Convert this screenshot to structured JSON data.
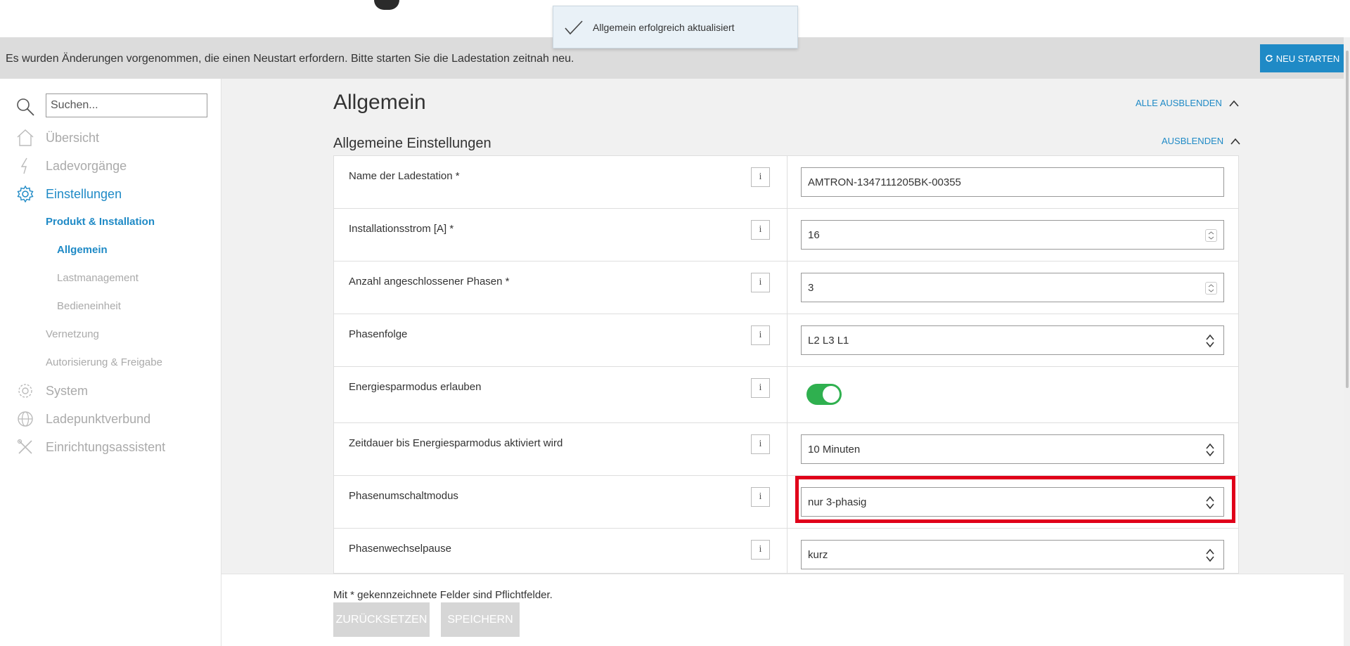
{
  "toast": {
    "message": "Allgemein erfolgreich aktualisiert"
  },
  "notice": {
    "text": "Es wurden Änderungen vorgenommen, die einen Neustart erfordern. Bitte starten Sie die Ladestation zeitnah neu.",
    "restart_label": "NEU STARTEN"
  },
  "sidebar": {
    "search_placeholder": "Suchen...",
    "items": [
      {
        "label": "Übersicht",
        "icon": "home-icon"
      },
      {
        "label": "Ladevorgänge",
        "icon": "lightning-icon"
      },
      {
        "label": "Einstellungen",
        "icon": "gear-icon"
      },
      {
        "label": "Produkt & Installation"
      },
      {
        "label": "Allgemein"
      },
      {
        "label": "Lastmanagement"
      },
      {
        "label": "Bedieneinheit"
      },
      {
        "label": "Vernetzung"
      },
      {
        "label": "Autorisierung & Freigabe"
      },
      {
        "label": "System",
        "icon": "system-gear-icon"
      },
      {
        "label": "Ladepunktverbund",
        "icon": "globe-icon"
      },
      {
        "label": "Einrichtungsassistent",
        "icon": "tools-icon"
      }
    ]
  },
  "main": {
    "title": "Allgemein",
    "collapse_all_label": "ALLE AUSBLENDEN",
    "section_title": "Allgemeine Einstellungen",
    "collapse_label": "AUSBLENDEN",
    "info_label": "i",
    "rows": [
      {
        "label": "Name der Ladestation *",
        "value": "AMTRON-1347111205BK-00355"
      },
      {
        "label": "Installationsstrom [A] *",
        "value": "16"
      },
      {
        "label": "Anzahl angeschlossener Phasen *",
        "value": "3"
      },
      {
        "label": "Phasenfolge",
        "value": "L2 L3 L1"
      },
      {
        "label": "Energiesparmodus erlauben",
        "value": "on"
      },
      {
        "label": "Zeitdauer bis Energiesparmodus aktiviert wird",
        "value": "10 Minuten"
      },
      {
        "label": "Phasenumschaltmodus",
        "value": "nur 3-phasig"
      },
      {
        "label": "Phasenwechselpause",
        "value": "kurz"
      }
    ]
  },
  "footer": {
    "note": "Mit * gekennzeichnete Felder sind Pflichtfelder.",
    "reset_label": "ZURÜCKSETZEN",
    "save_label": "SPEICHERN"
  },
  "colors": {
    "accent": "#1f8ac6",
    "toggle_on": "#2fb04f",
    "highlight": "#e0001a"
  }
}
